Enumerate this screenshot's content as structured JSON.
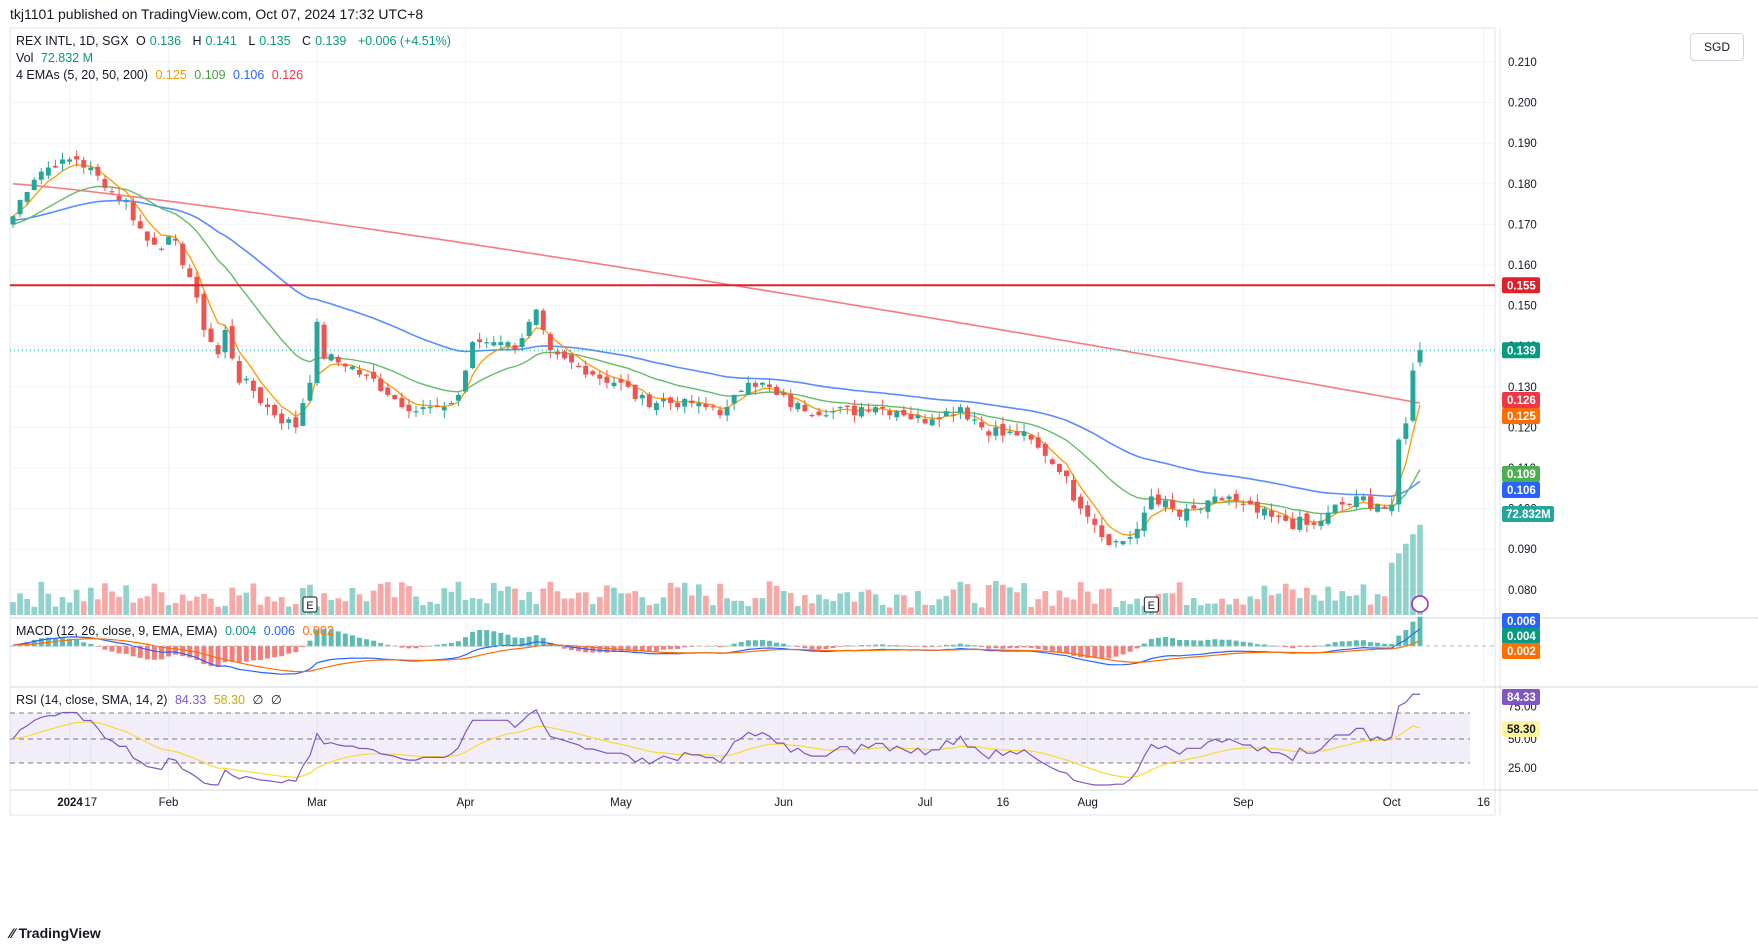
{
  "publisher": "tkj1101 published on TradingView.com, Oct 07, 2024 17:32 UTC+8",
  "currency": "SGD",
  "brand": "TradingView",
  "legend": {
    "symbol": "REX INTL, 1D, SGX",
    "open_label": "O",
    "open": "0.136",
    "high_label": "H",
    "high": "0.141",
    "low_label": "L",
    "low": "0.135",
    "close_label": "C",
    "close": "0.139",
    "change": "+0.006 (+4.51%)",
    "vol_label": "Vol",
    "vol": "72.832 M",
    "ema_label": "4 EMAs (5, 20, 50, 200)",
    "ema5": "0.125",
    "ema20": "0.109",
    "ema50": "0.106",
    "ema200": "0.126",
    "macd_label": "MACD (12, 26, close, 9, EMA, EMA)",
    "macd_hist": "0.004",
    "macd_line": "0.006",
    "macd_signal": "0.002",
    "rsi_label": "RSI (14, close, SMA, 14, 2)",
    "rsi": "84.33",
    "rsi_ma": "58.30",
    "rsi_extra1": "∅",
    "rsi_extra2": "∅"
  },
  "colors": {
    "up": "#26a69a",
    "down": "#ef5350",
    "ema5": "#ff9800",
    "ema20": "#4caf50",
    "ema50": "#2962ff",
    "ema200": "#f23645",
    "hline": "#e0202c",
    "macd": "#2962ff",
    "signal": "#ff6d00",
    "rsi": "#7e57c2",
    "rsi_ma": "#fdd835"
  },
  "chart_data": {
    "type": "candlestick",
    "price_axis": {
      "ylim": [
        0.074,
        0.213
      ],
      "ticks": [
        "0.210",
        "0.200",
        "0.190",
        "0.180",
        "0.170",
        "0.160",
        "0.150",
        "0.140",
        "0.130",
        "0.120",
        "0.110",
        "0.100",
        "0.090",
        "0.080"
      ]
    },
    "rsi_axis": {
      "ylim": [
        20,
        90
      ],
      "ticks": [
        "75.00",
        "50.00",
        "25.00"
      ],
      "bands": [
        70,
        50,
        30
      ]
    },
    "x_labels": [
      "2024",
      "17",
      "Feb",
      "Mar",
      "Apr",
      "May",
      "Jun",
      "Jul",
      "16",
      "Aug",
      "Sep",
      "Oct",
      "16"
    ],
    "horizontal_line": {
      "value": 0.155,
      "label": "0.155"
    },
    "last_price_label": "0.139",
    "axis_labels": {
      "ema200": "0.126",
      "ema5": "0.125",
      "ema20": "0.109",
      "ema50": "0.106",
      "volume": "72.832M",
      "macd_line": "0.006",
      "macd_hist": "0.004",
      "macd_signal": "0.002",
      "rsi": "84.33",
      "rsi_ma": "58.30"
    },
    "earnings_markers": [
      {
        "date": "2024-02-29",
        "label": "E"
      },
      {
        "date": "2024-08-14",
        "label": "E"
      }
    ],
    "close_anchors": [
      [
        "2024-01-02",
        0.172
      ],
      [
        "2024-01-05",
        0.182
      ],
      [
        "2024-01-10",
        0.185
      ],
      [
        "2024-01-15",
        0.186
      ],
      [
        "2024-01-19",
        0.18
      ],
      [
        "2024-01-24",
        0.175
      ],
      [
        "2024-01-29",
        0.166
      ],
      [
        "2024-02-02",
        0.165
      ],
      [
        "2024-02-06",
        0.157
      ],
      [
        "2024-02-08",
        0.145
      ],
      [
        "2024-02-12",
        0.138
      ],
      [
        "2024-02-13",
        0.143
      ],
      [
        "2024-02-15",
        0.132
      ],
      [
        "2024-02-20",
        0.127
      ],
      [
        "2024-02-23",
        0.122
      ],
      [
        "2024-02-27",
        0.12
      ],
      [
        "2024-02-29",
        0.132
      ],
      [
        "2024-03-01",
        0.145
      ],
      [
        "2024-03-04",
        0.138
      ],
      [
        "2024-03-08",
        0.135
      ],
      [
        "2024-03-14",
        0.13
      ],
      [
        "2024-03-20",
        0.125
      ],
      [
        "2024-03-26",
        0.124
      ],
      [
        "2024-03-29",
        0.128
      ],
      [
        "2024-04-02",
        0.14
      ],
      [
        "2024-04-05",
        0.142
      ],
      [
        "2024-04-10",
        0.14
      ],
      [
        "2024-04-15",
        0.148
      ],
      [
        "2024-04-17",
        0.138
      ],
      [
        "2024-04-22",
        0.136
      ],
      [
        "2024-04-29",
        0.132
      ],
      [
        "2024-05-06",
        0.127
      ],
      [
        "2024-05-14",
        0.126
      ],
      [
        "2024-05-22",
        0.124
      ],
      [
        "2024-05-27",
        0.132
      ],
      [
        "2024-05-30",
        0.129
      ],
      [
        "2024-06-05",
        0.125
      ],
      [
        "2024-06-14",
        0.124
      ],
      [
        "2024-06-20",
        0.126
      ],
      [
        "2024-06-28",
        0.122
      ],
      [
        "2024-07-03",
        0.123
      ],
      [
        "2024-07-08",
        0.125
      ],
      [
        "2024-07-12",
        0.119
      ],
      [
        "2024-07-19",
        0.118
      ],
      [
        "2024-07-23",
        0.115
      ],
      [
        "2024-07-26",
        0.11
      ],
      [
        "2024-07-30",
        0.103
      ],
      [
        "2024-08-02",
        0.097
      ],
      [
        "2024-08-06",
        0.091
      ],
      [
        "2024-08-12",
        0.094
      ],
      [
        "2024-08-14",
        0.103
      ],
      [
        "2024-08-20",
        0.098
      ],
      [
        "2024-08-26",
        0.101
      ],
      [
        "2024-08-29",
        0.103
      ],
      [
        "2024-09-02",
        0.1
      ],
      [
        "2024-09-10",
        0.097
      ],
      [
        "2024-09-16",
        0.096
      ],
      [
        "2024-09-20",
        0.101
      ],
      [
        "2024-09-25",
        0.102
      ],
      [
        "2024-10-01",
        0.1
      ],
      [
        "2024-10-02",
        0.117
      ],
      [
        "2024-10-03",
        0.122
      ],
      [
        "2024-10-04",
        0.133
      ],
      [
        "2024-10-07",
        0.139
      ]
    ],
    "last_candle": {
      "date": "2024-10-07",
      "open": 0.136,
      "high": 0.141,
      "low": 0.135,
      "close": 0.139,
      "volume": "72.832M"
    }
  }
}
